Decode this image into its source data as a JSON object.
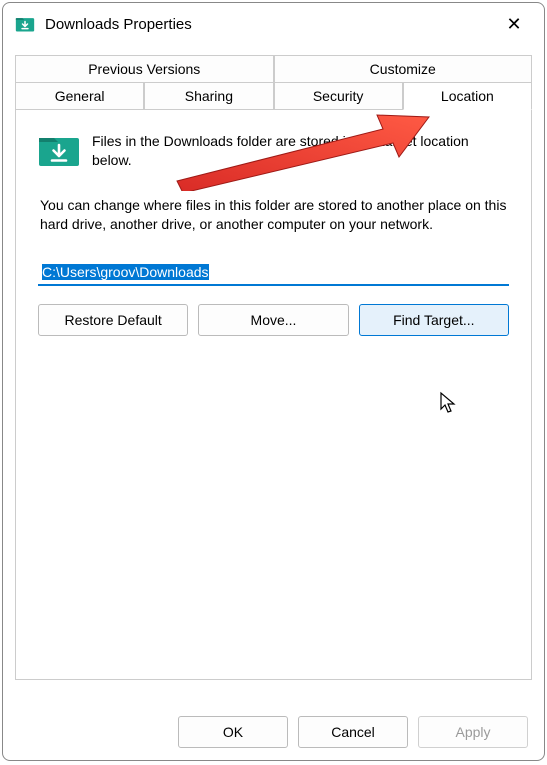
{
  "window": {
    "title": "Downloads Properties",
    "close_glyph": "✕"
  },
  "tabs": {
    "row1": [
      {
        "label": "Previous Versions"
      },
      {
        "label": "Customize"
      }
    ],
    "row2": [
      {
        "label": "General"
      },
      {
        "label": "Sharing"
      },
      {
        "label": "Security"
      },
      {
        "label": "Location",
        "active": true
      }
    ]
  },
  "location_tab": {
    "info": "Files in the Downloads folder are stored in the target location below.",
    "description": "You can change where files in this folder are stored to another place on this hard drive, another drive, or another computer on your network.",
    "path_value": "C:\\Users\\groov\\Downloads",
    "buttons": {
      "restore": "Restore Default",
      "move": "Move...",
      "find_target": "Find Target..."
    }
  },
  "footer": {
    "ok": "OK",
    "cancel": "Cancel",
    "apply": "Apply"
  },
  "colors": {
    "accent": "#0078d4",
    "folder_fill": "#1aa58e",
    "arrow": "#ed3833"
  },
  "icons": {
    "title_icon": "downloads-folder-icon",
    "folder_icon": "downloads-folder-icon",
    "close_icon": "close-icon",
    "arrow_annotation": "red-arrow-icon",
    "cursor_annotation": "cursor-icon"
  }
}
